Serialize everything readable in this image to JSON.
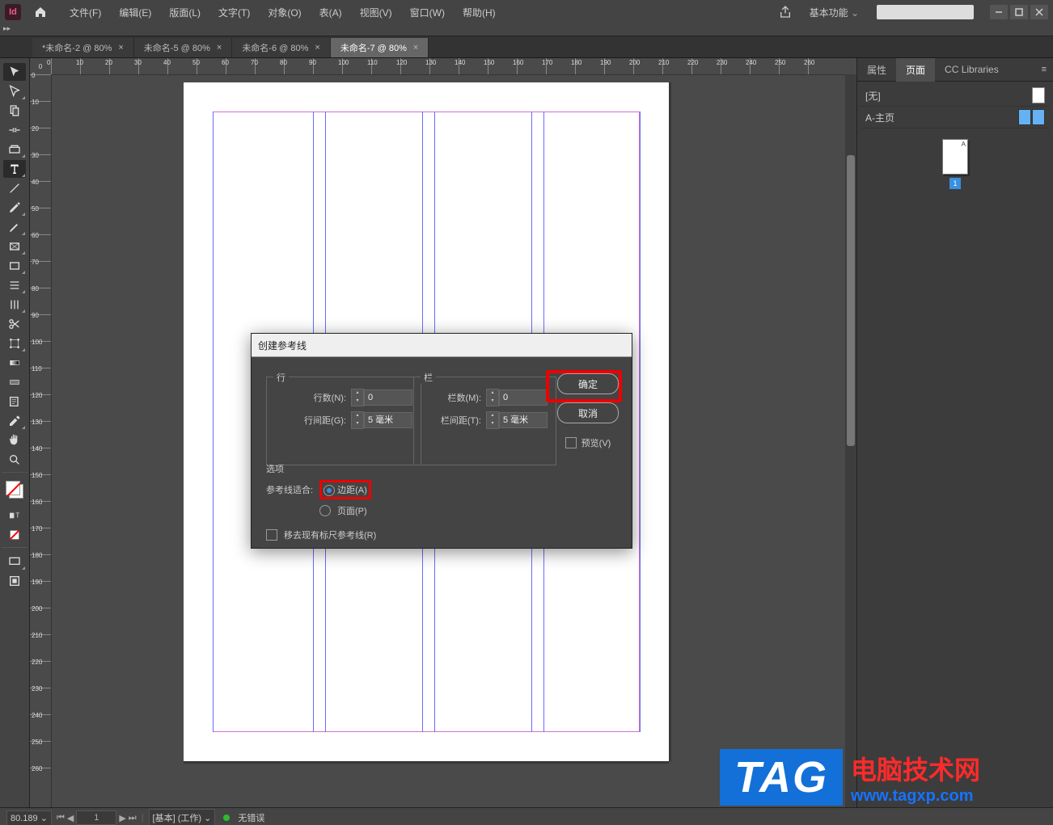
{
  "app": {
    "logo_text": "Id"
  },
  "menu": {
    "file": "文件(F)",
    "edit": "编辑(E)",
    "layout": "版面(L)",
    "type": "文字(T)",
    "object": "对象(O)",
    "table": "表(A)",
    "view": "视图(V)",
    "window": "窗口(W)",
    "help": "帮助(H)"
  },
  "topbar": {
    "workspace": "基本功能"
  },
  "tabs": [
    {
      "label": "*未命名-2 @ 80%",
      "active": false
    },
    {
      "label": "未命名-5 @ 80%",
      "active": false
    },
    {
      "label": "未命名-6 @ 80%",
      "active": false
    },
    {
      "label": "未命名-7 @ 80%",
      "active": true
    }
  ],
  "ruler": {
    "h_ticks": [
      0,
      10,
      20,
      30,
      40,
      50,
      60,
      70,
      80,
      90,
      100,
      110,
      120,
      130,
      140,
      150,
      160,
      170,
      180,
      190,
      200,
      210,
      220,
      230,
      240,
      250,
      260
    ],
    "v_ticks": [
      0,
      10,
      20,
      30,
      40,
      50,
      60,
      70,
      80,
      90,
      100,
      110,
      120,
      130,
      140,
      150,
      160,
      170,
      180,
      190,
      200,
      210,
      220,
      230,
      240,
      250,
      260
    ]
  },
  "ruler_corner": "0",
  "right_panel": {
    "tab_properties": "属性",
    "tab_pages": "页面",
    "tab_cc": "CC Libraries",
    "master_none": "[无]",
    "master_a": "A-主页",
    "page_label": "A",
    "page_number": "1"
  },
  "dialog": {
    "title": "创建参考线",
    "rows_group": "行",
    "rows_count_label": "行数(N):",
    "rows_count_value": "0",
    "rows_gutter_label": "行间距(G):",
    "rows_gutter_value": "5 毫米",
    "cols_group": "栏",
    "cols_count_label": "栏数(M):",
    "cols_count_value": "0",
    "cols_gutter_label": "栏间距(T):",
    "cols_gutter_value": "5 毫米",
    "options_group": "选项",
    "fit_label": "参考线适合:",
    "fit_margins": "边距(A)",
    "fit_page": "页面(P)",
    "remove_existing": "移去现有标尺参考线(R)",
    "ok": "确定",
    "cancel": "取消",
    "preview": "预览(V)"
  },
  "status": {
    "zoom": "80.189",
    "page": "1",
    "style": "[基本] (工作)",
    "errors": "无错误"
  },
  "watermark": {
    "tag": "TAG",
    "cn": "电脑技术网",
    "url": "www.tagxp.com"
  }
}
